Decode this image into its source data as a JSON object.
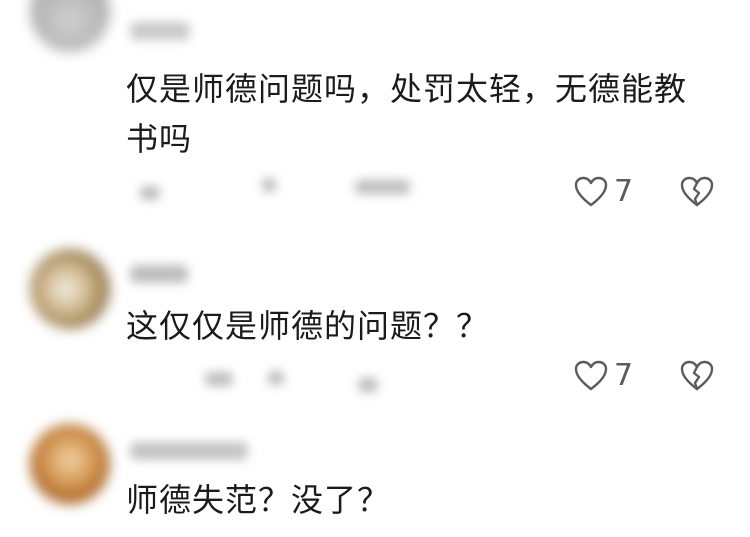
{
  "comments": [
    {
      "text": "仅是师德问题吗，处罚太轻，无德能教书吗",
      "likes": "7",
      "avatar_color": "#b8b8b8"
    },
    {
      "text": "这仅仅是师德的问题？？",
      "likes": "7",
      "avatar_color": "#b49a6a"
    },
    {
      "text": "师德失范？没了？",
      "avatar_color": "#c98a3c"
    }
  ],
  "icons": {
    "like": "heart-outline-icon",
    "dislike": "broken-heart-icon"
  },
  "colors": {
    "text": "#1b1b1b",
    "icon": "#5b5b5b",
    "background": "#ffffff"
  }
}
